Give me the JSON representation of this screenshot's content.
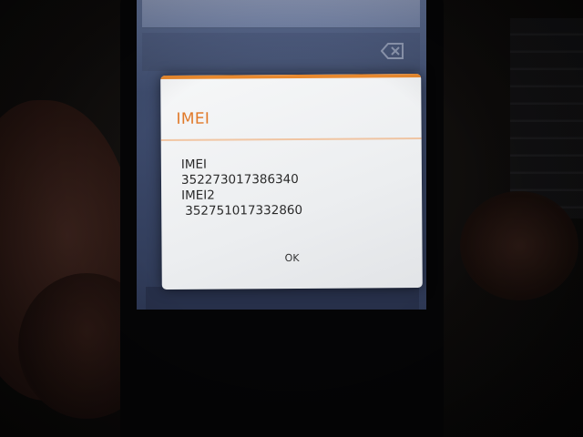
{
  "dialog": {
    "title": "IMEI",
    "label_1": "IMEI",
    "value_1": "352273017386340",
    "label_2": "IMEI2",
    "value_2": "352751017332860",
    "ok_label": "OK"
  },
  "icons": {
    "backspace": "backspace-icon"
  },
  "colors": {
    "accent": "#e17a2a",
    "dialog_background": "#f0f1f3",
    "screen_background": "#3f4d6f"
  }
}
